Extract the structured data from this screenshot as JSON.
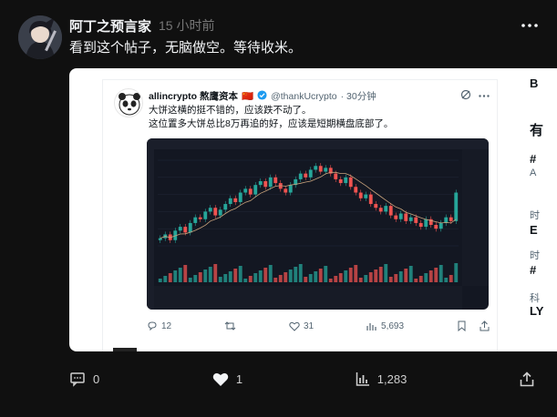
{
  "post": {
    "author": "阿丁之预言家",
    "time": "15 小时前",
    "text": "看到这个帖子，无脑做空。等待收米。"
  },
  "quoted_tweet": {
    "name": "allincrypto 熬鹰资本",
    "flag": "🇨🇳",
    "handle": "@thankUcrypto",
    "time": "· 30分钟",
    "line1": "大饼这横的挺不错的，应该跌不动了。",
    "line2": "这位置多大饼总比8万再追的好，应该是短期横盘底部了。",
    "replies": "12",
    "likes": "31",
    "views": "5,693"
  },
  "chart_data": {
    "type": "candlestick",
    "title": "",
    "xlabel": "",
    "ylabel": "",
    "series": [
      {
        "values": [
          34,
          36,
          33,
          38,
          40,
          37,
          42,
          45,
          44,
          48,
          50,
          46,
          49,
          52,
          55,
          53,
          58,
          60,
          57,
          62,
          64,
          61,
          66,
          63,
          60,
          58,
          62,
          65,
          68,
          66,
          70,
          72,
          69,
          71,
          68,
          65,
          63,
          66,
          61,
          58,
          55,
          57,
          52,
          50,
          48,
          51,
          46,
          44,
          47,
          43,
          45,
          42,
          40,
          44,
          41,
          39,
          42,
          45,
          43,
          58
        ]
      }
    ]
  },
  "side": {
    "l1": "B",
    "l2": "有",
    "l3": "#",
    "l4": "A",
    "l5": "时",
    "l6": "E",
    "l7": "时",
    "l8": "#",
    "l9": "科",
    "l10": "LY"
  },
  "actions": {
    "comments": "0",
    "likes": "1",
    "views": "1,283"
  },
  "colors": {
    "background": "#101010",
    "up": "#26a69a",
    "down": "#ef5350"
  }
}
